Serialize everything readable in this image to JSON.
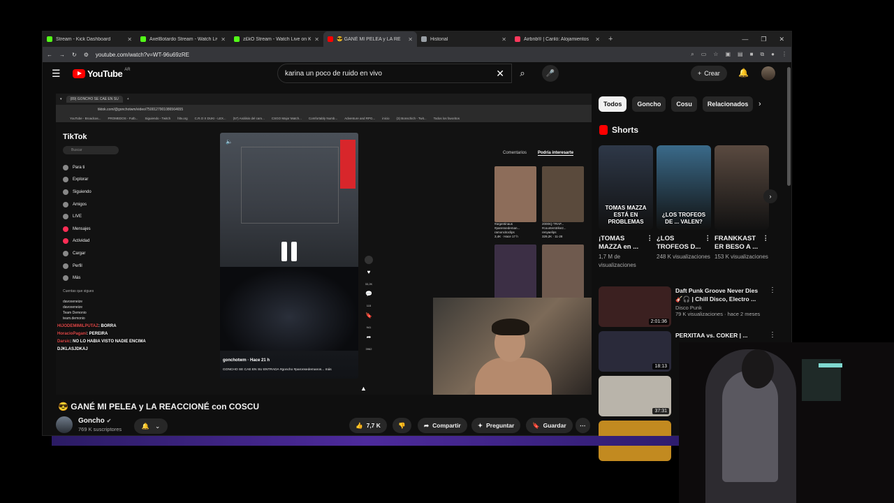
{
  "browser": {
    "tabs": [
      {
        "title": "Stream - Kick Dashboard",
        "favicon_color": "#53fc18",
        "active": false
      },
      {
        "title": "AxelBotardo Stream - Watch Live",
        "favicon_color": "#53fc18",
        "active": false
      },
      {
        "title": "z£kO Stream - Watch Live on K",
        "favicon_color": "#53fc18",
        "active": false
      },
      {
        "title": "😎 GANÉ MI PELEA y LA RE",
        "favicon_color": "#ff0000",
        "active": true
      },
      {
        "title": "Historial",
        "favicon_color": "#9aa0a6",
        "active": false
      },
      {
        "title": "Airbnb® | Cariló: Alojamientos",
        "favicon_color": "#ff385c",
        "active": false
      }
    ],
    "url": "youtube.com/watch?v=WT-96u69zRE"
  },
  "youtube": {
    "logo_text": "YouTube",
    "country_code": "AR",
    "search_value": "karina un poco de ruido en vivo",
    "create_label": "Crear"
  },
  "player": {
    "inner_tab": "(89) GONCHO SE CAE EN SU",
    "inner_url": "tiktok.com/@gonchotwm/video/7500127901086564655",
    "bookmarks": [
      "YouTube - Broadcas...",
      "PROMEDOS - Futb...",
      "Siguiendo - Twitch",
      "hltv.org",
      "C.R.O X DUKI - LEX...",
      "(57) Análisis del cam...",
      "CSGO Major Match...",
      "Comfortably Numb...",
      "Adventure and RPG...",
      "inicio",
      "(3) Bonschich - Twit...",
      "Todos los favoritos"
    ],
    "tiktok_logo": "TikTok",
    "tiktok_search": "Buscar",
    "nav": [
      "Para ti",
      "Explorar",
      "Siguiendo",
      "Amigos",
      "LIVE",
      "Mensajes",
      "Actividad",
      "Cargar",
      "Perfil",
      "Más"
    ],
    "following_header": "Cuentas que sigues",
    "following": [
      "davoxeneize",
      "davoxeneize",
      "Team Demonio",
      "team.demonio"
    ],
    "chat": [
      {
        "user": "HIJODEMIMILPUTAZ",
        "msg": ": BORRA"
      },
      {
        "user": "HoracioPagani",
        "msg": ": PEREIRA"
      },
      {
        "user": "Darsic",
        "msg": ": NO LO HABIA VISTO NADIE ENCIMA"
      },
      {
        "user": "",
        "msg": "DJKLASJDKAJ"
      }
    ],
    "video_user": "gonchotwm",
    "video_time": "Hace 21 h",
    "video_caption": "GONCHO SE CAE EN SU ENTRADA #goncho #paronsedemanos... más",
    "counts": [
      "33,2K",
      "115",
      "941",
      "3962"
    ],
    "side_tabs": [
      "Comentarios",
      "Podría interesarte"
    ],
    "side_thumbs": [
      {
        "cap1": "#argentinaus",
        "cap2": "#parensedeman...",
        "cap3": "ramoncitoclips",
        "cap4": "3,4K · Hace 17 h",
        "color": "#8d6d5a"
      },
      {
        "cap1": "2000IQ TRAP...",
        "cap2": "#counterstrike2...",
        "cap3": "renyaelips",
        "cap4": "329,2K · 11-28",
        "color": "#5a4a3c"
      },
      {
        "cap1": "",
        "cap2": "",
        "cap3": "",
        "cap4": "",
        "color": "#3c2f45"
      },
      {
        "cap1": "",
        "cap2": "",
        "cap3": "",
        "cap4": "",
        "color": "#6f5a4e"
      }
    ]
  },
  "chips": [
    "Todos",
    "Goncho",
    "Cosu",
    "Relacionados"
  ],
  "shorts": {
    "header": "Shorts",
    "items": [
      {
        "title": "¡TOMAS MAZZA en ...",
        "views": "1,7 M de visualizaciones",
        "overlay": "TOMAS MAZZA ESTÁ EN PROBLEMAS",
        "color": "#2e3848"
      },
      {
        "title": "¿LOS TROFEOS D...",
        "views": "248 K visualizaciones",
        "overlay": "¿LOS TROFEOS DE ... VALEN?",
        "color": "#3a6a8a"
      },
      {
        "title": "FRANKKAST ER BESO A ...",
        "views": "153 K visualizaciones",
        "overlay": "",
        "color": "#5a4a40"
      }
    ]
  },
  "recommendations": [
    {
      "title": "Daft Punk Groove Never Dies 🎸🎧 | Chill Disco, Electro ...",
      "channel": "Disco Punk",
      "meta": "79 K visualizaciones · hace 2 meses",
      "duration": "2:01:36",
      "color": "#3b2020"
    },
    {
      "title": "PERXITAA vs. COKER | ...",
      "channel": "",
      "meta": "",
      "duration": "18:13",
      "color": "#2a2a3a"
    },
    {
      "title": "",
      "channel": "",
      "meta": "",
      "duration": "37:31",
      "color": "#b9b4aa"
    },
    {
      "title": "",
      "channel": "",
      "meta": "",
      "duration": "",
      "color": "#c28a20"
    }
  ],
  "video": {
    "title": "😎 GANÉ MI PELEA y LA REACCIONÉ con COSCU",
    "channel": "Goncho",
    "subscribers": "769 K suscriptores",
    "likes": "7,7 K",
    "share": "Compartir",
    "ask": "Preguntar",
    "save": "Guardar"
  }
}
